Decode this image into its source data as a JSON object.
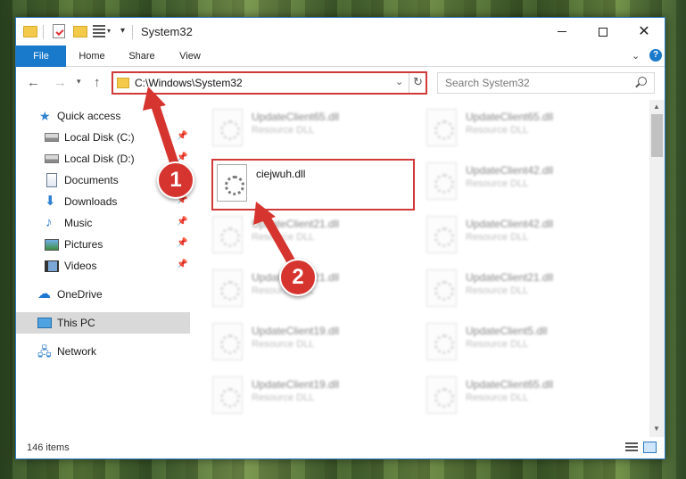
{
  "window": {
    "title": "System32",
    "accent": "#1979ca"
  },
  "ribbon": {
    "tabs": [
      "File",
      "Home",
      "Share",
      "View"
    ]
  },
  "address": {
    "path": "C:\\Windows\\System32"
  },
  "search": {
    "placeholder": "Search System32"
  },
  "sidebar": {
    "items": [
      {
        "label": "Quick access",
        "icon": "star-icon"
      },
      {
        "label": "Local Disk (C:)",
        "icon": "drive-icon",
        "pinned": true
      },
      {
        "label": "Local Disk (D:)",
        "icon": "drive-icon",
        "pinned": true
      },
      {
        "label": "Documents",
        "icon": "documents-icon",
        "pinned": true
      },
      {
        "label": "Downloads",
        "icon": "downloads-icon",
        "pinned": true
      },
      {
        "label": "Music",
        "icon": "music-icon",
        "pinned": true
      },
      {
        "label": "Pictures",
        "icon": "pictures-icon",
        "pinned": true
      },
      {
        "label": "Videos",
        "icon": "videos-icon",
        "pinned": true
      },
      {
        "label": "OneDrive",
        "icon": "onedrive-icon"
      },
      {
        "label": "This PC",
        "icon": "computer-icon",
        "selected": true
      },
      {
        "label": "Network",
        "icon": "network-icon"
      }
    ]
  },
  "files": {
    "left": [
      {
        "name": "UpdateClient65.dll",
        "type": "Resource DLL"
      },
      {
        "name": "ciejwuh.dll",
        "type": ""
      },
      {
        "name": "UpdateClient21.dll",
        "type": "Resource DLL"
      },
      {
        "name": "UpdateClient21.dll",
        "type": "Resource DLL"
      },
      {
        "name": "UpdateClient19.dll",
        "type": "Resource DLL"
      },
      {
        "name": "UpdateClient19.dll",
        "type": "Resource DLL"
      }
    ],
    "right": [
      {
        "name": "UpdateClient65.dll",
        "type": "Resource DLL"
      },
      {
        "name": "UpdateClient42.dll",
        "type": "Resource DLL"
      },
      {
        "name": "UpdateClient42.dll",
        "type": "Resource DLL"
      },
      {
        "name": "UpdateClient21.dll",
        "type": "Resource DLL"
      },
      {
        "name": "UpdateClient5.dll",
        "type": "Resource DLL"
      },
      {
        "name": "UpdateClient65.dll",
        "type": "Resource DLL"
      }
    ]
  },
  "status": {
    "count": "146 items"
  },
  "annotations": {
    "step1": "1",
    "step2": "2",
    "color": "#d6342f"
  }
}
